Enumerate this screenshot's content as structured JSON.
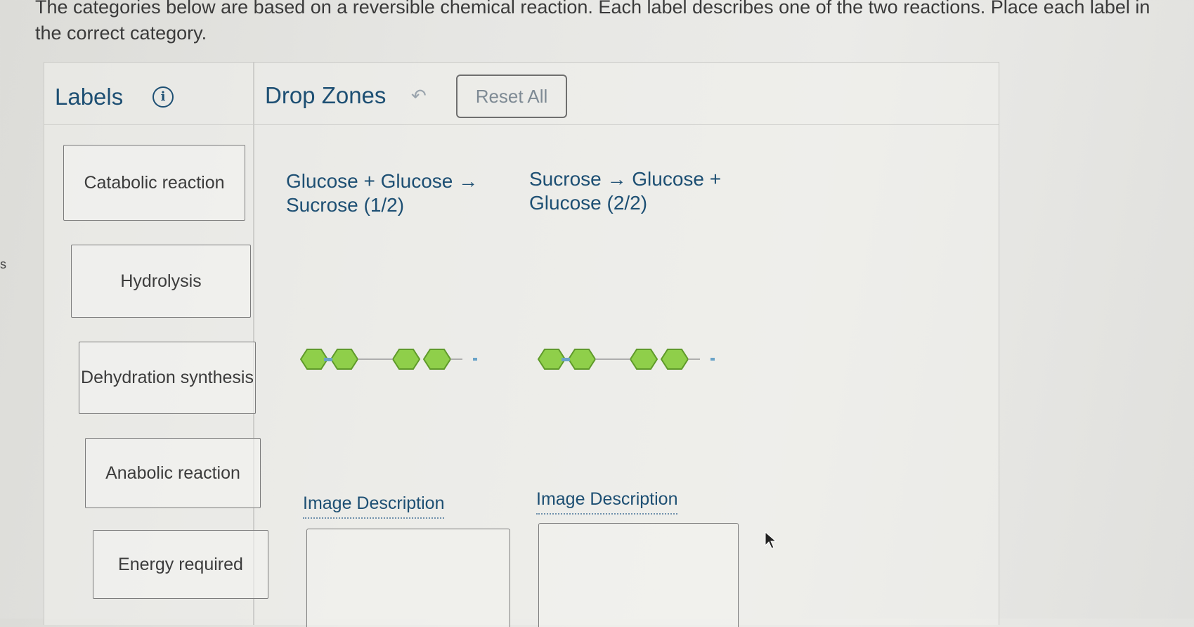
{
  "instructions": "The categories below are based on a reversible chemical reaction. Each label describes one of the two reactions. Place each label in the correct category.",
  "edge_letter": "s",
  "labels_panel": {
    "title": "Labels",
    "info_icon": "info-icon"
  },
  "drop_panel": {
    "title": "Drop Zones",
    "undo_icon": "undo-arrow-icon",
    "reset_label": "Reset All"
  },
  "labels": [
    {
      "text": "Catabolic reaction"
    },
    {
      "text": "Hydrolysis"
    },
    {
      "text": "Dehydration synthesis"
    },
    {
      "text": "Anabolic reaction"
    },
    {
      "text": "Energy required"
    }
  ],
  "zones": [
    {
      "title_line1": "Glucose + Glucose →",
      "title_line2": "Sucrose (1/2)",
      "image_description": "Image Description"
    },
    {
      "title_line1": "Sucrose → Glucose +",
      "title_line2": "Glucose (2/2)",
      "image_description": "Image Description"
    }
  ],
  "colors": {
    "heading": "#1d4f73",
    "molecule_fill": "#8fcf4a",
    "molecule_stroke": "#5f9a2a"
  }
}
